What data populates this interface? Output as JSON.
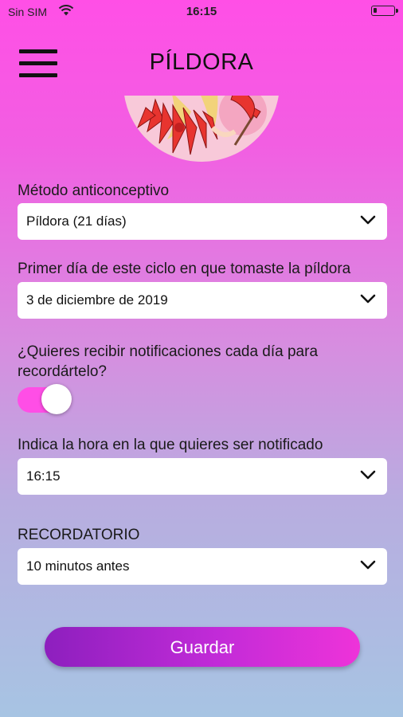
{
  "status_bar": {
    "carrier": "Sin SIM",
    "time": "16:15"
  },
  "header": {
    "title": "PÍLDORA",
    "menu_icon": "hamburger-menu-icon"
  },
  "form": {
    "method": {
      "label": "Método anticonceptivo",
      "value": "Píldora (21 días)"
    },
    "first_day": {
      "label": "Primer día de este ciclo en que tomaste la píldora",
      "value": "3 de diciembre de 2019"
    },
    "notifications": {
      "label": "¿Quieres recibir notificaciones cada día para recordártelo?",
      "enabled": true
    },
    "notify_time": {
      "label": "Indica la hora en la que quieres ser notificado",
      "value": "16:15"
    },
    "reminder": {
      "label": "RECORDATORIO",
      "value": "10 minutos antes"
    }
  },
  "save_button": {
    "label": "Guardar"
  },
  "colors": {
    "accent": "#ff4ee6",
    "button_start": "#8d1fbe",
    "button_end": "#ee33d9"
  }
}
